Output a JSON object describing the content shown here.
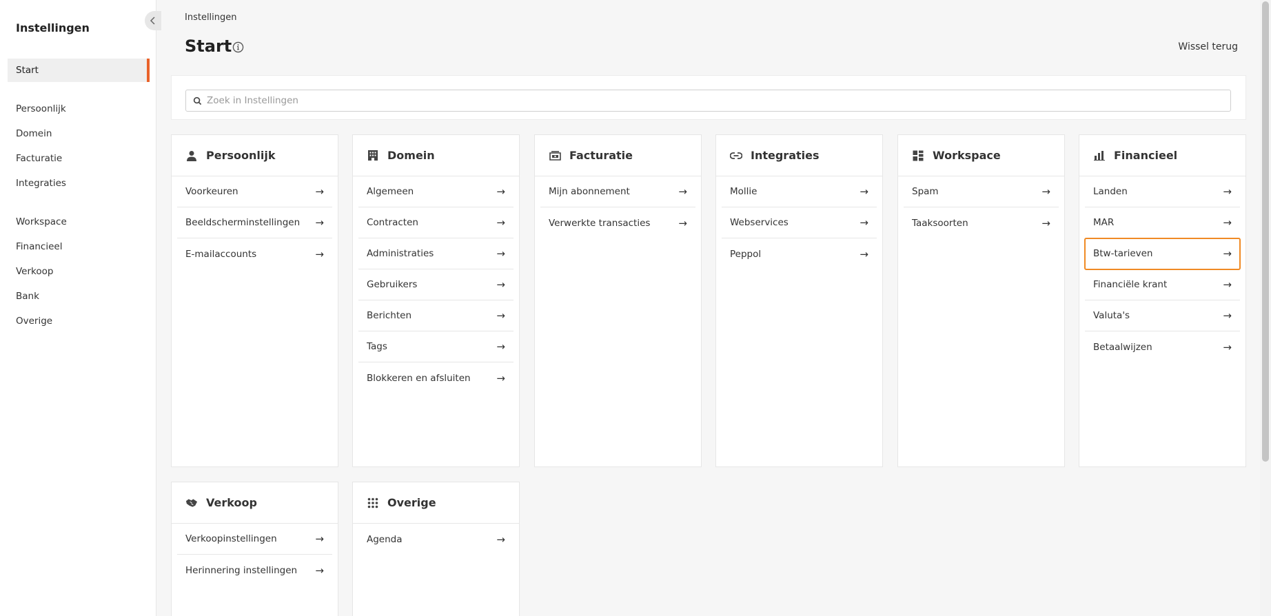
{
  "sidebar": {
    "title": "Instellingen",
    "items": [
      {
        "label": "Start"
      },
      {
        "label": "Persoonlijk"
      },
      {
        "label": "Domein"
      },
      {
        "label": "Facturatie"
      },
      {
        "label": "Integraties"
      },
      {
        "label": "Workspace"
      },
      {
        "label": "Financieel"
      },
      {
        "label": "Verkoop"
      },
      {
        "label": "Bank"
      },
      {
        "label": "Overige"
      }
    ],
    "active": "Start"
  },
  "header": {
    "breadcrumb": "Instellingen",
    "title": "Start",
    "switch_back": "Wissel terug"
  },
  "search": {
    "placeholder": "Zoek in Instellingen",
    "value": ""
  },
  "cards": [
    {
      "title": "Persoonlijk",
      "icon": "person-icon",
      "items": [
        "Voorkeuren",
        "Beeldscherminstellingen",
        "E-mailaccounts"
      ]
    },
    {
      "title": "Domein",
      "icon": "building-icon",
      "items": [
        "Algemeen",
        "Contracten",
        "Administraties",
        "Gebruikers",
        "Berichten",
        "Tags",
        "Blokkeren en afsluiten"
      ]
    },
    {
      "title": "Facturatie",
      "icon": "billing-icon",
      "items": [
        "Mijn abonnement",
        "Verwerkte transacties"
      ]
    },
    {
      "title": "Integraties",
      "icon": "link-icon",
      "items": [
        "Mollie",
        "Webservices",
        "Peppol"
      ]
    },
    {
      "title": "Workspace",
      "icon": "workspace-icon",
      "items": [
        "Spam",
        "Taaksoorten"
      ]
    },
    {
      "title": "Financieel",
      "icon": "bar-chart-icon",
      "items": [
        "Landen",
        "MAR",
        "Btw-tarieven",
        "Financiële krant",
        "Valuta's",
        "Betaalwijzen"
      ]
    },
    {
      "title": "Verkoop",
      "icon": "handshake-icon",
      "items": [
        "Verkoopinstellingen",
        "Herinnering instellingen"
      ]
    },
    {
      "title": "Overige",
      "icon": "grid-dots-icon",
      "items": [
        "Agenda"
      ]
    }
  ],
  "highlighted_item": "Btw-tarieven",
  "colors": {
    "accent": "#e9622a",
    "highlight": "#f08a24"
  }
}
